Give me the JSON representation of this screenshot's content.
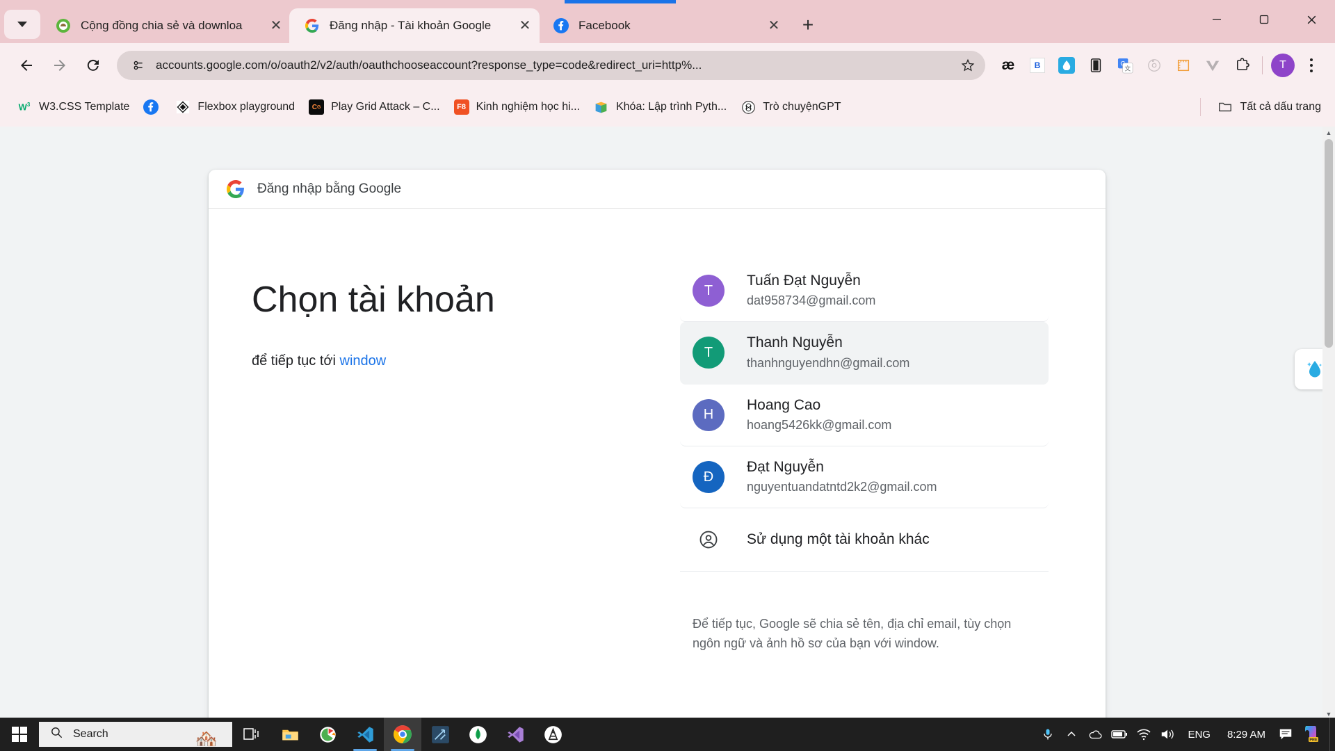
{
  "browser": {
    "tab_search_icon": "chevron-down-icon",
    "new_tab_label": "+",
    "tabs": [
      {
        "title": "Cộng đồng chia sẻ và downloa",
        "favicon": "apkmody-icon",
        "active": false,
        "close_label": "✕"
      },
      {
        "title": "Đăng nhập - Tài khoản Google",
        "favicon": "google-icon",
        "active": true,
        "close_label": "✕"
      },
      {
        "title": "Facebook",
        "favicon": "facebook-icon",
        "active": false,
        "close_label": "✕"
      }
    ],
    "window_controls": {
      "minimize": "minimize-icon",
      "maximize": "maximize-icon",
      "close": "close-icon"
    },
    "toolbar": {
      "back": "back-arrow-icon",
      "forward": "forward-arrow-icon",
      "reload": "reload-icon",
      "site_info_icon": "page-info-icon",
      "url": "accounts.google.com/o/oauth2/v2/auth/oauthchooseaccount?response_type=code&redirect_uri=http%...",
      "bookmark_star": "star-icon",
      "extensions": [
        "aesthetic-extension-icon",
        "bitwarden-extension-icon",
        "water-drop-extension-icon",
        "dark-reader-extension-icon",
        "google-translate-extension-icon",
        "loom-extension-icon",
        "ruler-extension-icon",
        "vue-devtools-extension-icon",
        "extensions-puzzle-icon"
      ],
      "profile_initial": "T",
      "menu_icon": "kebab-menu-icon"
    },
    "bookmarks": [
      {
        "label": "W3.CSS Template",
        "icon": "w3schools-icon"
      },
      {
        "label": "",
        "icon": "facebook-icon"
      },
      {
        "label": "Flexbox playground",
        "icon": "flexbox-icon"
      },
      {
        "label": "Play Grid Attack – C...",
        "icon": "cssgridattack-icon"
      },
      {
        "label": "Kinh nghiệm học hi...",
        "icon": "f8-icon"
      },
      {
        "label": "Khóa: Lập trình Pyth...",
        "icon": "moodle-book-icon"
      },
      {
        "label": "Trò chuyệnGPT",
        "icon": "chatgpt-icon"
      }
    ],
    "all_bookmarks": {
      "label": "Tất cả dấu trang",
      "icon": "folder-icon"
    }
  },
  "page": {
    "card_header": {
      "logo": "google-g-logo",
      "title": "Đăng nhập bằng Google"
    },
    "heading": "Chọn tài khoản",
    "subtitle_prefix": "để tiếp tục tới ",
    "subtitle_link": "window",
    "accounts": [
      {
        "initial": "T",
        "avatar_color": "#8e5fd3",
        "name": "Tuấn Đạt Nguyễn",
        "email": "dat958734@gmail.com",
        "selected": false
      },
      {
        "initial": "T",
        "avatar_color": "#129b77",
        "name": "Thanh Nguyễn",
        "email": "thanhnguyendhn@gmail.com",
        "selected": true
      },
      {
        "initial": "H",
        "avatar_color": "#5c6bc0",
        "name": "Hoang Cao",
        "email": "hoang5426kk@gmail.com",
        "selected": false
      },
      {
        "initial": "Đ",
        "avatar_color": "#1565c0",
        "name": "Đạt Nguyễn",
        "email": "nguyentuandatntd2k2@gmail.com",
        "selected": false
      }
    ],
    "use_another_account": {
      "icon": "account-circle-icon",
      "label": "Sử dụng một tài khoản khác"
    },
    "footnote": "Để tiếp tục, Google sẽ chia sẻ tên, địa chỉ email, tùy chọn ngôn ngữ và ảnh hồ sơ của bạn với window.",
    "side_widget_icon": "water-drop-widget-icon",
    "accent_link_color": "#1a73e8"
  },
  "taskbar": {
    "start_icon": "windows-start-icon",
    "search": {
      "placeholder": "Search",
      "icon": "search-icon",
      "art": "village-illustration"
    },
    "task_view_icon": "task-view-icon",
    "apps": [
      {
        "name": "file-explorer-icon",
        "running": false,
        "active": false
      },
      {
        "name": "ccleaner-icon",
        "running": false,
        "active": false
      },
      {
        "name": "vs-code-icon",
        "running": true,
        "active": false
      },
      {
        "name": "google-chrome-icon",
        "running": true,
        "active": true
      },
      {
        "name": "scratch-editor-icon",
        "running": false,
        "active": false
      },
      {
        "name": "mongodb-compass-icon",
        "running": false,
        "active": false
      },
      {
        "name": "visual-studio-icon",
        "running": false,
        "active": false
      },
      {
        "name": "android-studio-icon",
        "running": false,
        "active": false
      }
    ],
    "tray": {
      "mic_icon": "microphone-icon",
      "overflow_icon": "show-hidden-icons-chevron",
      "onedrive_icon": "onedrive-icon",
      "battery_icon": "battery-icon",
      "network_icon": "wifi-icon",
      "volume_icon": "volume-icon",
      "language": "ENG",
      "clock": "8:29 AM",
      "notifications_icon": "notification-center-icon",
      "copilot_icon": "copilot-pre-icon",
      "show_desktop": "show-desktop-button"
    }
  }
}
